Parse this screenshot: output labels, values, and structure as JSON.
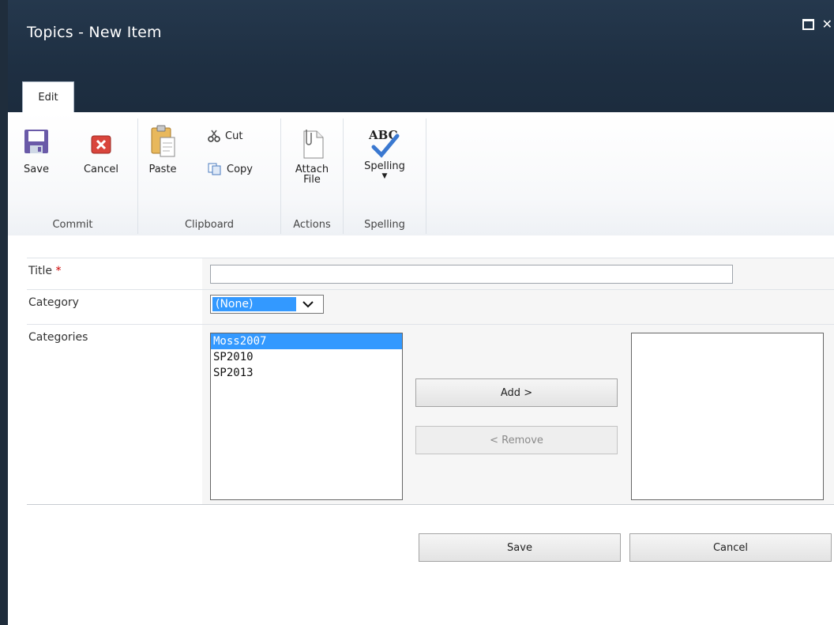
{
  "window": {
    "title": "Topics - New Item"
  },
  "ribbon": {
    "tab": "Edit",
    "commit": {
      "group_label": "Commit",
      "save": "Save",
      "cancel": "Cancel"
    },
    "clipboard": {
      "group_label": "Clipboard",
      "paste": "Paste",
      "cut": "Cut",
      "copy": "Copy"
    },
    "actions": {
      "group_label": "Actions",
      "attach_line1": "Attach",
      "attach_line2": "File"
    },
    "spelling": {
      "group_label": "Spelling",
      "spelling": "Spelling",
      "abc": "ABC"
    }
  },
  "form": {
    "title_label": "Title",
    "required_mark": "*",
    "title_value": "",
    "category_label": "Category",
    "category_value": "(None)",
    "categories_label": "Categories",
    "available": [
      "Moss2007",
      "SP2010",
      "SP2013"
    ],
    "selected_available": "Moss2007",
    "add_button": "Add >",
    "remove_button": "< Remove",
    "save_button": "Save",
    "cancel_button": "Cancel"
  },
  "colors": {
    "titlebar": "#1e2f42",
    "selection": "#3399ff",
    "required": "#cc0000"
  }
}
